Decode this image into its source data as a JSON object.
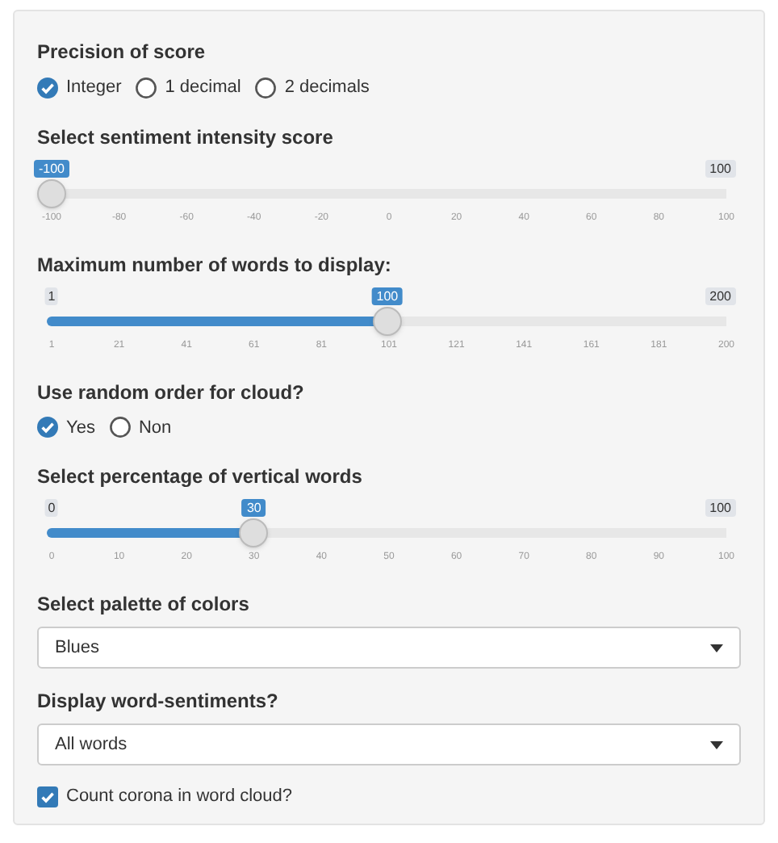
{
  "controls": [
    {
      "kind": "radio",
      "label": "Precision of score",
      "options": [
        {
          "label": "Integer",
          "selected": true
        },
        {
          "label": "1 decimal",
          "selected": false
        },
        {
          "label": "2 decimals",
          "selected": false
        }
      ]
    },
    {
      "kind": "slider",
      "label": "Select sentiment intensity score",
      "max_label": "100",
      "value_label": "-100",
      "level": 0,
      "ticks": [
        "-100",
        "-80",
        "-60",
        "-40",
        "-20",
        "0",
        "20",
        "40",
        "60",
        "80",
        "100"
      ]
    },
    {
      "kind": "slider",
      "label": "Maximum number of words to display:",
      "min_label": "1",
      "max_label": "200",
      "value_label": "100",
      "level": 0.4975,
      "ticks": [
        "1",
        "21",
        "41",
        "61",
        "81",
        "101",
        "121",
        "141",
        "161",
        "181",
        "200"
      ]
    },
    {
      "kind": "radio",
      "label": "Use random order for cloud?",
      "options": [
        {
          "label": "Yes",
          "selected": true
        },
        {
          "label": "Non",
          "selected": false
        }
      ]
    },
    {
      "kind": "slider",
      "label": "Select percentage of vertical words",
      "min_label": "0",
      "max_label": "100",
      "value_label": "30",
      "level": 0.3,
      "ticks": [
        "0",
        "10",
        "20",
        "30",
        "40",
        "50",
        "60",
        "70",
        "80",
        "90",
        "100"
      ]
    },
    {
      "kind": "select",
      "label": "Select palette of colors",
      "value": "Blues"
    },
    {
      "kind": "select",
      "label": "Display word-sentiments?",
      "value": "All words"
    },
    {
      "kind": "checkbox",
      "label": "Count corona in word cloud?",
      "checked": true
    }
  ]
}
